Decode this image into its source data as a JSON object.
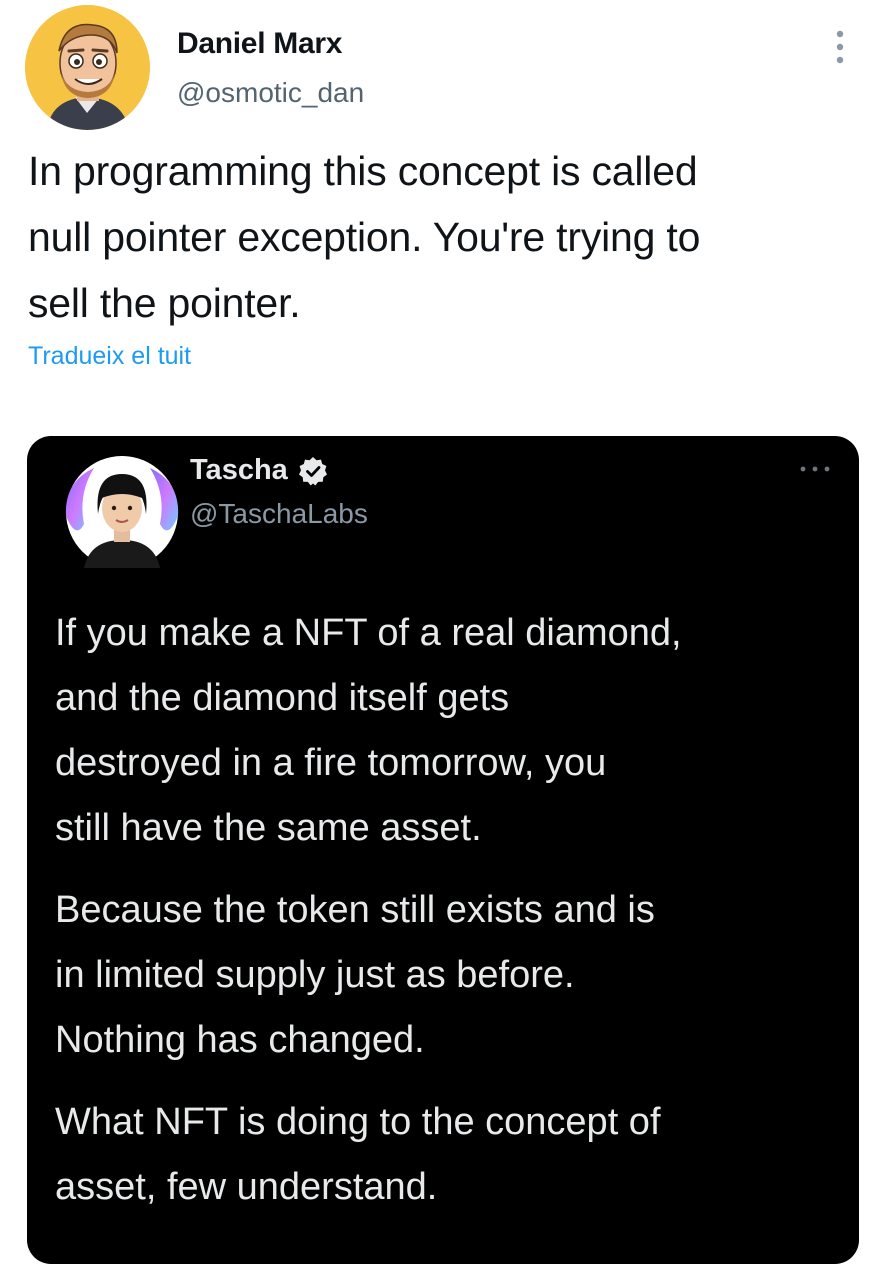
{
  "tweet": {
    "author": {
      "name": "Daniel Marx",
      "handle": "@osmotic_dan",
      "avatar_icon": "cartoon-avatar-icon"
    },
    "text_lines": [
      "In programming this concept is called",
      "null pointer exception. You're trying to",
      "sell the pointer."
    ],
    "translate_label": "Tradueix el tuit",
    "more_icon": "more-vertical-icon"
  },
  "quoted": {
    "author": {
      "name": "Tascha",
      "handle": "@TaschaLabs",
      "verified": true,
      "avatar_icon": "portrait-avatar-icon"
    },
    "paragraphs": [
      [
        "If you make a NFT of a real diamond,",
        "and the diamond itself gets",
        "destroyed in a fire tomorrow, you",
        "still have the same asset."
      ],
      [
        "Because the token still exists and is",
        "in limited supply just as before.",
        "Nothing has changed."
      ],
      [
        "What NFT is doing to the concept of",
        "asset, few understand."
      ]
    ],
    "more_icon": "more-horizontal-icon"
  },
  "colors": {
    "text": "#0f1419",
    "secondary_text": "#536471",
    "link": "#1d9bf0",
    "quote_background": "#000000",
    "quote_text": "#e7e9ea",
    "quote_secondary_text": "#8b98a5",
    "avatar_background": "#f6c343"
  }
}
